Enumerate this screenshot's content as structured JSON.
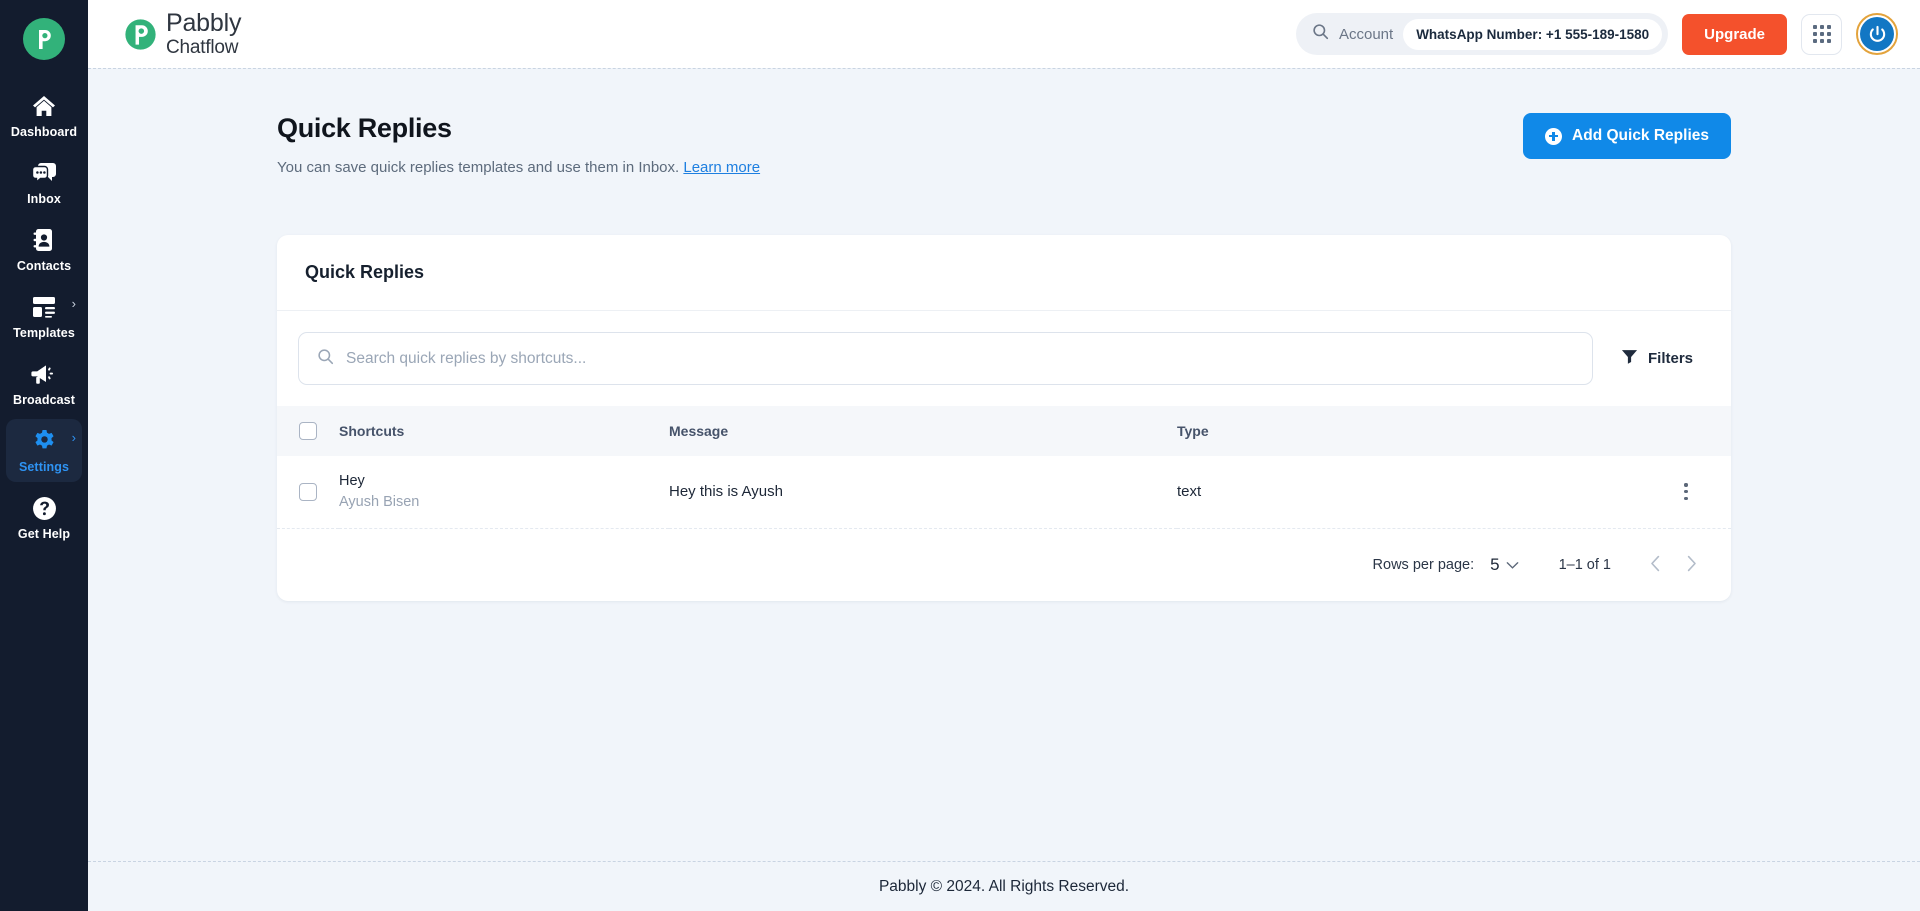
{
  "sidebar": {
    "brand_icon": "pabbly-logo-icon",
    "items": [
      {
        "label": "Dashboard",
        "icon": "home-icon",
        "active": false,
        "chevron": false
      },
      {
        "label": "Inbox",
        "icon": "chat-bubble-icon",
        "active": false,
        "chevron": false
      },
      {
        "label": "Contacts",
        "icon": "contact-book-icon",
        "active": false,
        "chevron": false
      },
      {
        "label": "Templates",
        "icon": "layout-template-icon",
        "active": false,
        "chevron": true
      },
      {
        "label": "Broadcast",
        "icon": "megaphone-icon",
        "active": false,
        "chevron": false
      },
      {
        "label": "Settings",
        "icon": "gear-icon",
        "active": true,
        "chevron": true
      },
      {
        "label": "Get Help",
        "icon": "question-circle-icon",
        "active": false,
        "chevron": false
      }
    ]
  },
  "topbar": {
    "logo_name": "Pabbly",
    "logo_product": "Chatflow",
    "account_label": "Account",
    "whatsapp_number": "WhatsApp Number: +1 555-189-1580",
    "upgrade_label": "Upgrade",
    "apps_icon": "grid-apps-icon",
    "avatar_icon": "user-avatar-icon"
  },
  "page": {
    "title": "Quick Replies",
    "subtitle": "You can save quick replies templates and use them in Inbox.",
    "learn_more": "Learn more",
    "add_button": "Add Quick Replies"
  },
  "card": {
    "title": "Quick Replies",
    "search_placeholder": "Search quick replies by shortcuts...",
    "search_value": "",
    "filters_label": "Filters",
    "columns": [
      "Shortcuts",
      "Message",
      "Type"
    ],
    "rows": [
      {
        "shortcut": "Hey",
        "shortcut_sub": "Ayush Bisen",
        "message": "Hey this is Ayush",
        "type": "text"
      }
    ],
    "pagination": {
      "rows_per_page_label": "Rows per page:",
      "rows_per_page_value": "5",
      "range": "1–1 of 1"
    }
  },
  "footer": {
    "text": "Pabbly © 2024. All Rights Reserved."
  },
  "colors": {
    "sidebar_bg": "#131c2e",
    "accent_blue": "#1089e8",
    "upgrade_orange": "#f4512c",
    "brand_green": "#32b27a",
    "page_bg": "#f1f5fa"
  }
}
